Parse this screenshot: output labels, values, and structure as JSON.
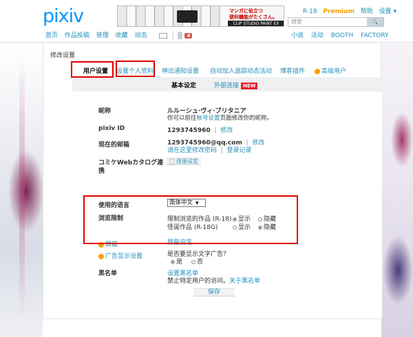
{
  "header": {
    "logo": "pixiv",
    "banner": {
      "line1": "マンガに役立つ",
      "line2": "便利機能がたくさん。",
      "line3": "CLIP STUDIO PAINT EX"
    },
    "toplinks": [
      "R-18",
      "Premium",
      "帮助",
      "设置 ▾"
    ],
    "search_placeholder": "搜索",
    "search_button": "🔍",
    "nav": [
      "首页",
      "作品投稿",
      "管理",
      "收藏",
      "动态"
    ],
    "notification_count": "4",
    "rnav": [
      "小说",
      "活动",
      "BOOTH",
      "FACTORY"
    ]
  },
  "panel": {
    "title": "修改设置",
    "tabs": [
      "用户设置",
      "设置个人资料",
      "神出通知设置",
      "自动加入追踪动态活动",
      "博客插件",
      "高级用户"
    ],
    "subtabs": [
      "基本设定",
      "外部连接"
    ],
    "new_badge": "NEW"
  },
  "settings": {
    "nickname": {
      "label": "昵称",
      "value": "ルルーシュ·ヴィ·ブリタニア",
      "hint_pre": "你可以前往",
      "hint_link": "帐号设置",
      "hint_post": "页面修改你的昵称。"
    },
    "pixiv_id": {
      "label": "pixiv ID",
      "value": "1293745960",
      "edit": "修改"
    },
    "email": {
      "label": "现在的邮箱",
      "value": "1293745960@qq.com",
      "edit": "修改",
      "change_password": "请在这里修改密码",
      "login_history": "登录记录"
    },
    "comike": {
      "label_1": "コミケWebカタログ連",
      "label_2": "携",
      "button": "连接设定"
    },
    "language": {
      "label": "使用的语言",
      "selected": "简体中文"
    },
    "browsing": {
      "label": "浏览限制",
      "r18_label": "限制浏览的作品 (R-18)",
      "r18g_label": "怪诞作品 (R-18G)",
      "show": "显示",
      "hide": "隐藏",
      "r18_value": "显示",
      "r18g_value": "隐藏"
    },
    "mute": {
      "label": "屏蔽",
      "link": "屏蔽设定"
    },
    "ads": {
      "label": "广告显示设置",
      "question": "是否要显示文字广告？",
      "yes": "是",
      "no": "否",
      "value": "是"
    },
    "blacklist": {
      "label": "黑名单",
      "link": "设置黑名单",
      "desc_pre": "禁止特定用户的访问。",
      "desc_link": "关于黑名单"
    },
    "save": "保存"
  },
  "colors": {
    "accent": "#0096fa",
    "link": "#258fb8",
    "highlight": "#e00000",
    "premium": "#f5a100"
  }
}
